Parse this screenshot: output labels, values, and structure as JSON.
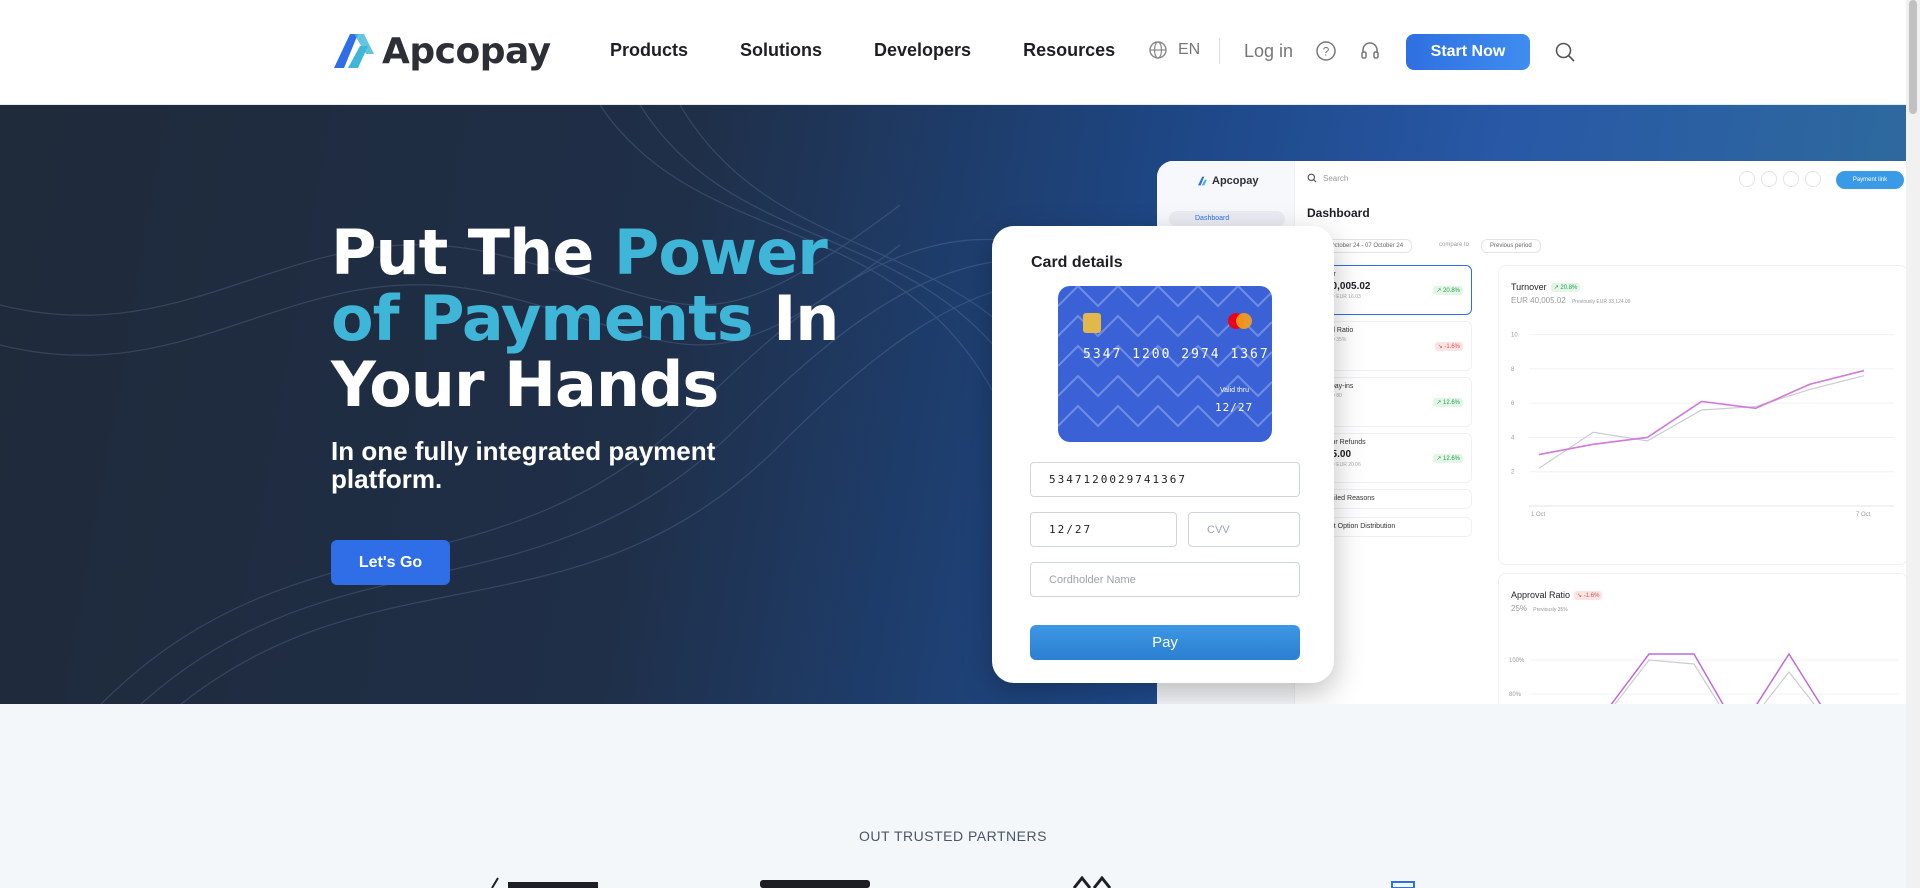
{
  "header": {
    "brand": "Apcopay",
    "nav": [
      {
        "label": "Products"
      },
      {
        "label": "Solutions"
      },
      {
        "label": "Developers"
      },
      {
        "label": "Resources"
      }
    ],
    "language": "EN",
    "login_label": "Log in",
    "cta_label": "Start Now"
  },
  "hero": {
    "title_part1": "Put The ",
    "title_accent": "Power of Payments",
    "title_part2": " In Your Hands",
    "subtitle": "In one fully integrated payment platform.",
    "button_label": "Let's Go"
  },
  "dashboard": {
    "brand": "Apcopay",
    "nav_item": "Dashboard",
    "search_placeholder": "Search",
    "payment_link": "Payment link",
    "title": "Dashboard",
    "date_range": "October 24 - 07 October 24",
    "compare_label": "compare to",
    "period": "Previous period",
    "metrics": [
      {
        "label": "ver",
        "value": "40,005.02",
        "sub": "usly EUR 16.03",
        "badge": "↗ 20.8%",
        "trend": "up"
      },
      {
        "label": "val Ratio",
        "value": "",
        "sub": "usly 35%",
        "badge": "↘ -1.6%",
        "trend": "down"
      },
      {
        "label": "l' pay-ins",
        "value": "",
        "sub": "usly 80",
        "badge": "↗ 12.6%",
        "trend": "up"
      },
      {
        "label": "s or Refunds",
        "value": "35.00",
        "sub": "usly EUR 20.06",
        "badge": "↗ 12.6%",
        "trend": "up"
      },
      {
        "label": "Failed Reasons"
      },
      {
        "label": "ent Option Distribution"
      }
    ],
    "turnover": {
      "title": "Turnover",
      "badge": "↗ 20.8%",
      "value": "EUR 40,005.02",
      "previous": "Previously EUR 33,124.09",
      "y_ticks": [
        "10",
        "8",
        "6",
        "4",
        "2"
      ],
      "x_ticks": [
        "1 Oct",
        "7 Oct"
      ],
      "series_current": [
        3.0,
        3.6,
        4.0,
        6.1,
        5.7,
        7.1,
        7.9
      ],
      "series_previous": [
        2.2,
        4.3,
        3.8,
        5.6,
        5.8,
        6.8,
        7.6
      ]
    },
    "approval": {
      "title": "Approval Ratio",
      "badge": "↘ -1.6%",
      "value": "25%",
      "previous": "Previously 35%",
      "y_ticks": [
        "100%",
        "80%"
      ]
    }
  },
  "card_form": {
    "title": "Card details",
    "card_number_display": "5347  1200  2974  1367",
    "valid_thru_label": "Valid thru",
    "card_expiry_display": "12/27",
    "card_number_value": "5347120029741367",
    "expiry_value": "12/27",
    "cvv_placeholder": "CVV",
    "cardholder_placeholder": "Cordholder Name",
    "pay_label": "Pay"
  },
  "partners": {
    "label": "OUT TRUSTED PARTNERS"
  },
  "colors": {
    "accent": "#3fb6d8",
    "primary_button": "#2f6ee6",
    "hero_dark": "#1f2a3a",
    "hero_blue": "#2858a6"
  }
}
